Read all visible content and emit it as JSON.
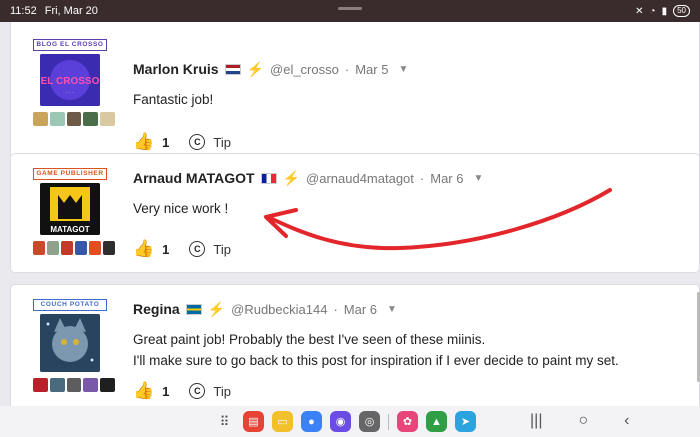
{
  "status_bar": {
    "time": "11:52",
    "date": "Fri, Mar 20",
    "battery": "50"
  },
  "comments": [
    {
      "badge_text": "BLOG EL CROSSO",
      "badge_color": "#5a3db0",
      "avatar_text": "EL CROSSO",
      "name": "Marlon Kruis",
      "flag": "nl",
      "handle": "@el_crosso",
      "date": "Mar 5",
      "text": [
        "Fantastic job!"
      ],
      "likes": "1",
      "tip_label": "Tip"
    },
    {
      "badge_text": "GAME PUBLISHER",
      "badge_color": "#d9521f",
      "avatar_text": "MATAGOT",
      "name": "Arnaud MATAGOT",
      "flag": "fr",
      "handle": "@arnaud4matagot",
      "date": "Mar 6",
      "text": [
        "Very nice work !"
      ],
      "likes": "1",
      "tip_label": "Tip"
    },
    {
      "badge_text": "COUCH POTATO",
      "badge_color": "#3f6bd0",
      "avatar_text": "",
      "name": "Regina",
      "flag": "se",
      "handle": "@Rudbeckia144",
      "date": "Mar 6",
      "text": [
        "Great paint job! Probably the best I've seen of these miinis.",
        "I'll make sure to go back to this post for inspiration if I ever decide to paint my set."
      ],
      "likes": "1",
      "tip_label": "Tip"
    }
  ],
  "colors": {
    "accent_bolt": "#f2a41b",
    "like": "#3a9a2d",
    "annotation": "#e3262b"
  }
}
